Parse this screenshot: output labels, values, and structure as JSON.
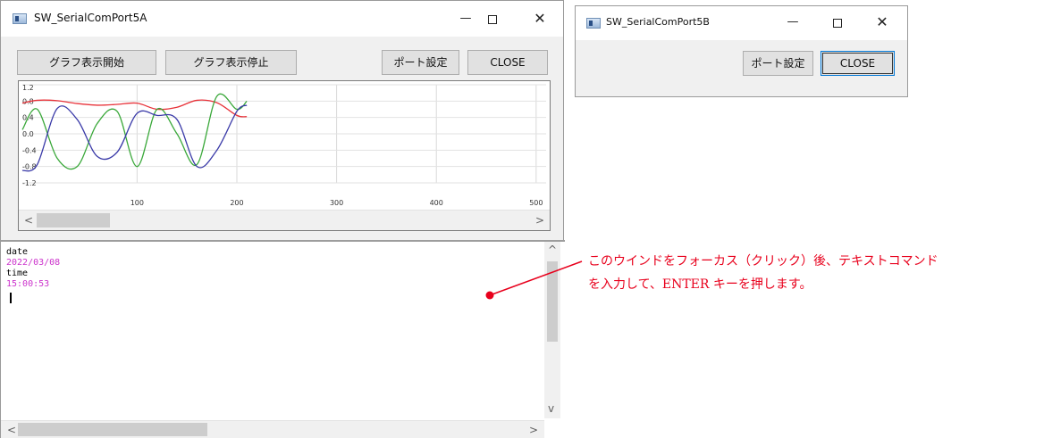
{
  "window_a": {
    "title": "SW_SerialComPort5A",
    "controls": {
      "minimize": "—",
      "close": "✕"
    },
    "buttons": {
      "graph_start": "グラフ表示開始",
      "graph_stop": "グラフ表示停止",
      "port_settings": "ポート設定",
      "close": "CLOSE"
    },
    "chart_data": {
      "type": "line",
      "title": "",
      "xlabel": "",
      "ylabel": "",
      "xlim": [
        -15,
        510
      ],
      "ylim": [
        -1.2,
        1.2
      ],
      "x_ticks": [
        "100",
        "200",
        "300",
        "400",
        "500"
      ],
      "y_ticks": [
        "1.2",
        "0.8",
        "0.4",
        "0.0",
        "-0.4",
        "-0.8",
        "-1.2"
      ],
      "grid": true,
      "legend": "none",
      "series": [
        {
          "color": "#e8333a",
          "x": [
            -15,
            0,
            20,
            40,
            60,
            80,
            100,
            120,
            140,
            160,
            180,
            200,
            210
          ],
          "y": [
            0.75,
            0.82,
            0.81,
            0.74,
            0.7,
            0.72,
            0.75,
            0.6,
            0.65,
            0.82,
            0.76,
            0.45,
            0.42
          ]
        },
        {
          "color": "#3aa83a",
          "x": [
            -15,
            0,
            20,
            40,
            60,
            80,
            100,
            120,
            140,
            160,
            180,
            200,
            210
          ],
          "y": [
            0.1,
            0.6,
            -0.6,
            -0.8,
            0.25,
            0.55,
            -0.8,
            0.6,
            0.0,
            -0.75,
            0.92,
            0.6,
            0.8
          ]
        },
        {
          "color": "#3a3aa8",
          "x": [
            -15,
            0,
            20,
            40,
            60,
            80,
            100,
            120,
            140,
            160,
            180,
            200,
            210
          ],
          "y": [
            -0.9,
            -0.75,
            0.62,
            0.35,
            -0.55,
            -0.45,
            0.5,
            0.45,
            0.35,
            -0.8,
            -0.4,
            0.55,
            0.7
          ]
        }
      ]
    },
    "terminal": {
      "lines": [
        {
          "text": "date",
          "color": "#000000"
        },
        {
          "text": "2022/03/08",
          "color": "#cc33cc"
        },
        {
          "text": "time",
          "color": "#000000"
        },
        {
          "text": "15:00:53",
          "color": "#cc33cc"
        }
      ]
    },
    "scroll": {
      "left_arrow": "<",
      "right_arrow": ">",
      "up_arrow": "^",
      "down_arrow": "v"
    }
  },
  "window_b": {
    "title": "SW_SerialComPort5B",
    "controls": {
      "minimize": "—",
      "close": "✕"
    },
    "buttons": {
      "port_settings": "ポート設定",
      "close": "CLOSE"
    }
  },
  "annotation": {
    "line1": "このウインドをフォーカス（クリック）後、テキストコマンド",
    "line2": "を入力して、ENTER キーを押します。",
    "color": "#e8001c"
  }
}
